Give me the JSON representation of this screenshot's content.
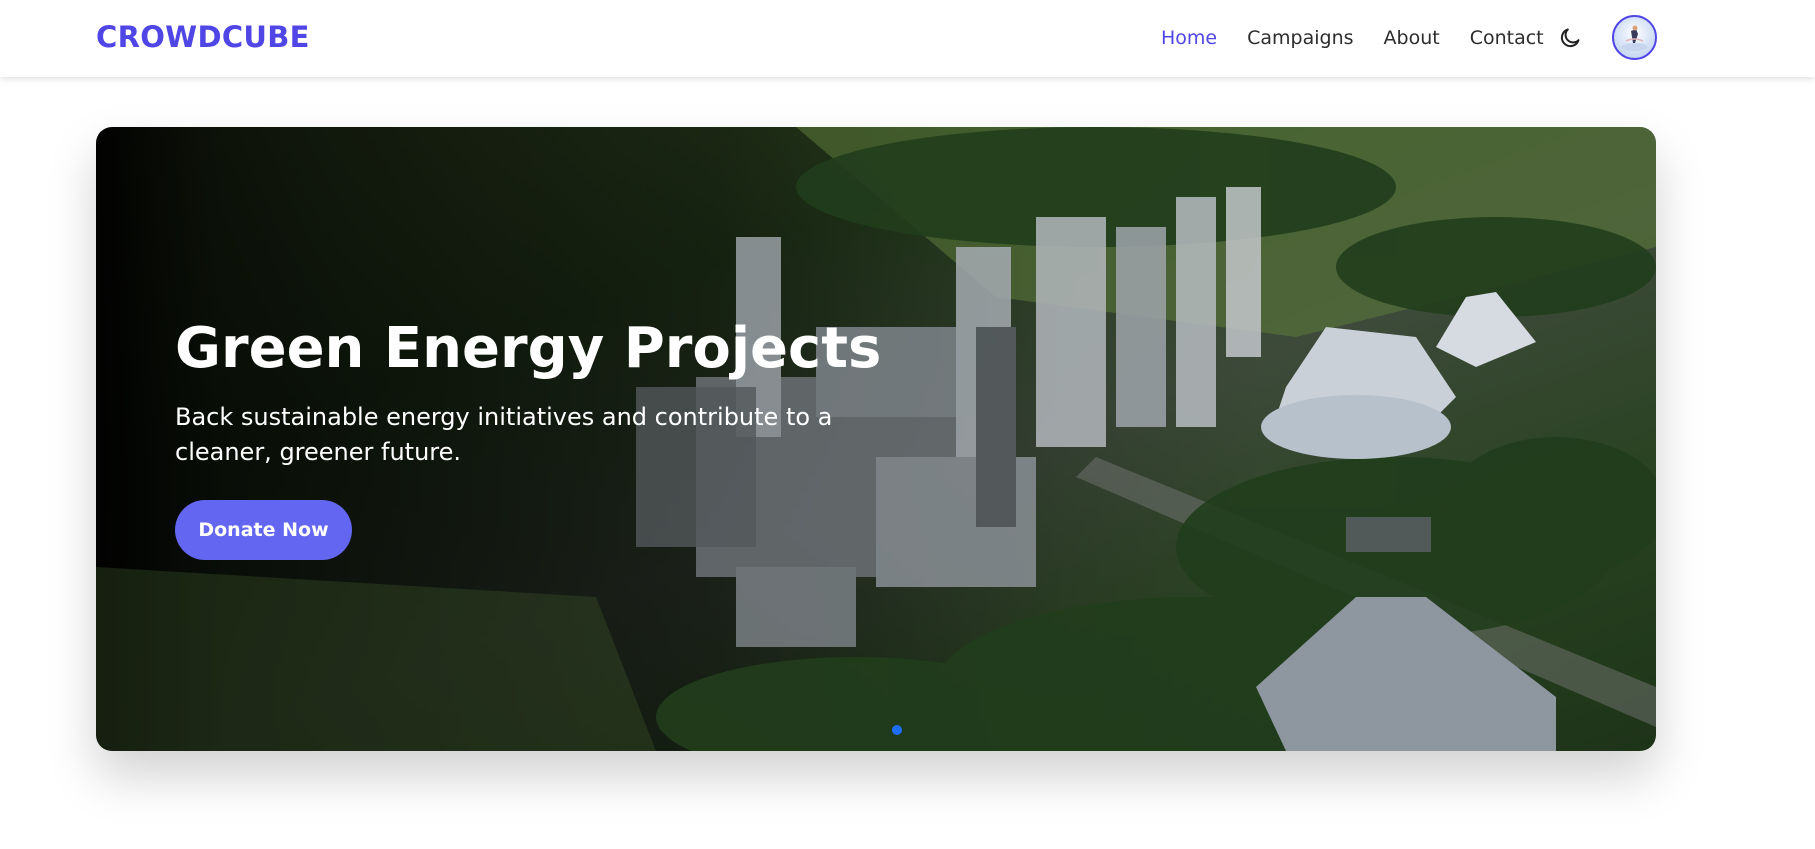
{
  "brand": {
    "name": "CROWDCUBE"
  },
  "nav": {
    "items": [
      {
        "label": "Home",
        "active": true
      },
      {
        "label": "Campaigns",
        "active": false
      },
      {
        "label": "About",
        "active": false
      },
      {
        "label": "Contact",
        "active": false
      }
    ],
    "theme_toggle_icon": "moon-icon",
    "avatar_icon": "user-avatar"
  },
  "hero": {
    "title": "Green Energy Projects",
    "description": "Back sustainable energy initiatives and contribute to a cleaner, greener future.",
    "cta_label": "Donate Now",
    "slide_count": 1,
    "active_slide": 1
  },
  "colors": {
    "brand": "#4f46e5",
    "button": "#6366f1",
    "active_dot": "#1e6fff"
  }
}
